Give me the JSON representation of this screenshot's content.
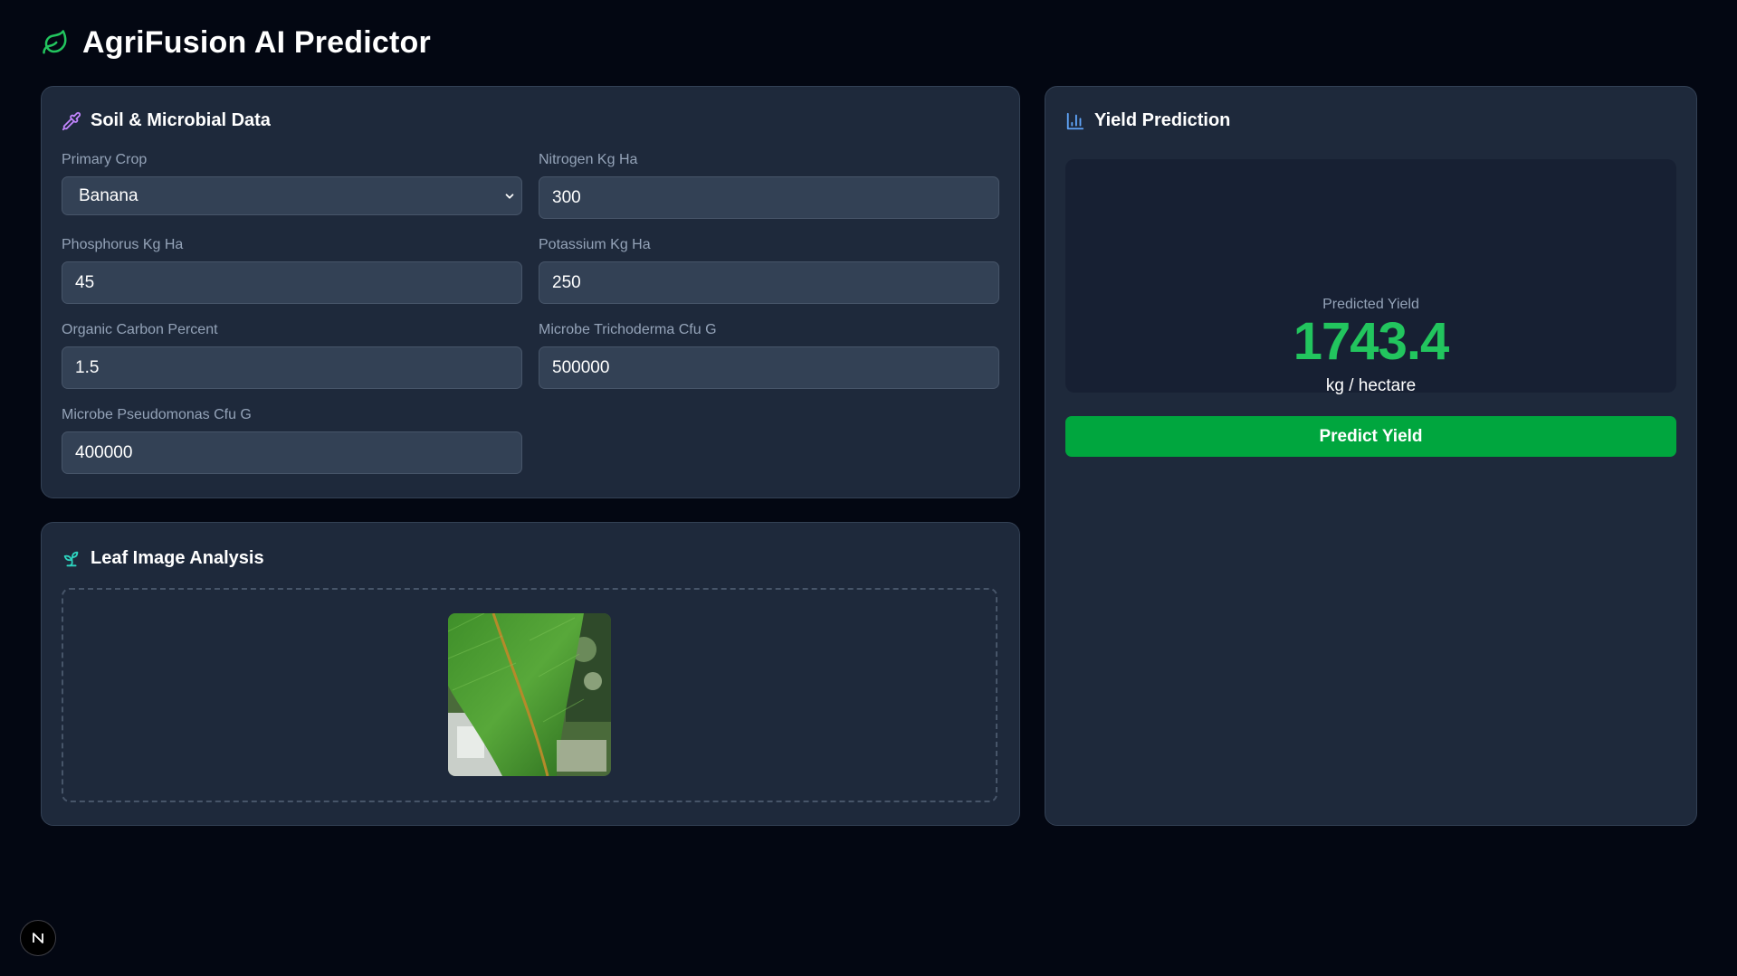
{
  "app": {
    "title": "AgriFusion AI Predictor",
    "logo_icon": "leaf-icon",
    "accent_color": "#22c55e"
  },
  "soil": {
    "title": "Soil & Microbial Data",
    "icon": "pipette-icon",
    "fields": {
      "primary_crop": {
        "label": "Primary Crop",
        "value": "Banana"
      },
      "nitrogen": {
        "label": "Nitrogen Kg Ha",
        "value": "300"
      },
      "phosphorus": {
        "label": "Phosphorus Kg Ha",
        "value": "45"
      },
      "potassium": {
        "label": "Potassium Kg Ha",
        "value": "250"
      },
      "organic_carbon": {
        "label": "Organic Carbon Percent",
        "value": "1.5"
      },
      "trichoderma": {
        "label": "Microbe Trichoderma Cfu G",
        "value": "500000"
      },
      "pseudomonas": {
        "label": "Microbe Pseudomonas Cfu G",
        "value": "400000"
      }
    }
  },
  "leaf": {
    "title": "Leaf Image Analysis",
    "icon": "sprout-icon"
  },
  "yield": {
    "title": "Yield Prediction",
    "icon": "bar-chart-icon",
    "caption": "Predicted Yield",
    "value": "1743.4",
    "unit": "kg / hectare",
    "button_label": "Predict Yield",
    "button_color": "#00a63e"
  },
  "badge": {
    "letter": "N"
  }
}
